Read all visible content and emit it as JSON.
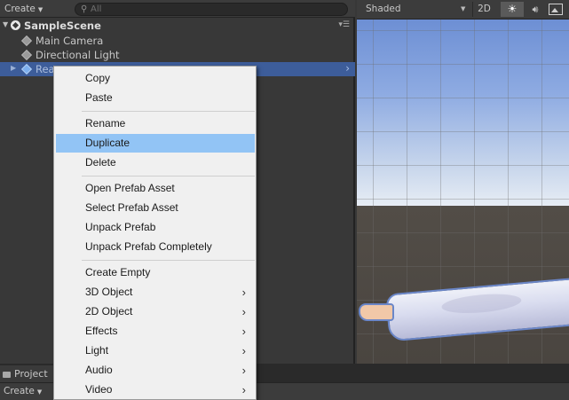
{
  "hierarchy": {
    "create_label": "Create",
    "search_placeholder": "All",
    "scene_name": "SampleScene",
    "items": [
      {
        "label": "Main Camera"
      },
      {
        "label": "Directional Light"
      },
      {
        "label": "Rea"
      }
    ]
  },
  "scene_view": {
    "shading_mode": "Shaded",
    "mode_2d": "2D"
  },
  "project": {
    "tab_label": "Project",
    "create_label": "Create"
  },
  "context_menu": {
    "items": [
      {
        "label": "Copy"
      },
      {
        "label": "Paste"
      },
      {
        "label": "Rename"
      },
      {
        "label": "Duplicate",
        "highlighted": true
      },
      {
        "label": "Delete"
      },
      {
        "label": "Open Prefab Asset"
      },
      {
        "label": "Select Prefab Asset"
      },
      {
        "label": "Unpack Prefab"
      },
      {
        "label": "Unpack Prefab Completely"
      },
      {
        "label": "Create Empty"
      },
      {
        "label": "3D Object",
        "submenu": true
      },
      {
        "label": "2D Object",
        "submenu": true
      },
      {
        "label": "Effects",
        "submenu": true
      },
      {
        "label": "Light",
        "submenu": true
      },
      {
        "label": "Audio",
        "submenu": true
      },
      {
        "label": "Video",
        "submenu": true
      }
    ]
  },
  "colors": {
    "selection": "#3d5d9a",
    "menu_highlight": "#92c4f5",
    "outline": "#6a86c8"
  }
}
